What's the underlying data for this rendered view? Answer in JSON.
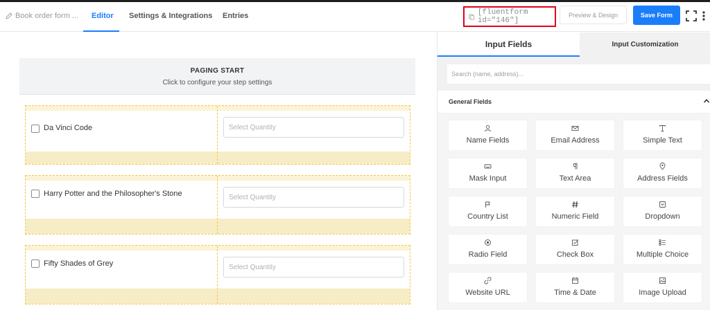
{
  "header": {
    "breadcrumb": "Book order form ...",
    "tabs": [
      {
        "label": "Editor",
        "active": true
      },
      {
        "label": "Settings & Integrations",
        "active": false
      },
      {
        "label": "Entries",
        "active": false
      }
    ],
    "shortcode": "[fluentform id=\"146\"]",
    "preview_label": "Preview & Design",
    "save_label": "Save Form"
  },
  "editor": {
    "paging_title": "PAGING START",
    "paging_subtitle": "Click to configure your step settings",
    "rows": [
      {
        "book": "Da Vinci Code",
        "placeholder": "Select Quantity"
      },
      {
        "book": "Harry Potter and the Philosopher's Stone",
        "placeholder": "Select Quantity"
      },
      {
        "book": "Fifty Shades of Grey",
        "placeholder": "Select Quantity"
      }
    ]
  },
  "panel": {
    "tabs": [
      "Input Fields",
      "Input Customization"
    ],
    "search_placeholder": "Search (name, address)...",
    "section_title": "General Fields",
    "fields": [
      {
        "label": "Name Fields",
        "icon": "user-icon"
      },
      {
        "label": "Email Address",
        "icon": "envelope-icon"
      },
      {
        "label": "Simple Text",
        "icon": "text-icon"
      },
      {
        "label": "Mask Input",
        "icon": "keyboard-icon"
      },
      {
        "label": "Text Area",
        "icon": "paragraph-icon"
      },
      {
        "label": "Address Fields",
        "icon": "map-pin-icon"
      },
      {
        "label": "Country List",
        "icon": "flag-icon"
      },
      {
        "label": "Numeric Field",
        "icon": "hash-icon"
      },
      {
        "label": "Dropdown",
        "icon": "dropdown-icon"
      },
      {
        "label": "Radio Field",
        "icon": "radio-icon"
      },
      {
        "label": "Check Box",
        "icon": "checkbox-icon"
      },
      {
        "label": "Multiple Choice",
        "icon": "list-icon"
      },
      {
        "label": "Website URL",
        "icon": "link-icon"
      },
      {
        "label": "Time & Date",
        "icon": "calendar-icon"
      },
      {
        "label": "Image Upload",
        "icon": "image-icon"
      }
    ]
  },
  "colors": {
    "accent": "#1a7efb",
    "highlight_border": "#e2001a",
    "row_border": "#f5c542",
    "row_band": "#f6edc6"
  }
}
